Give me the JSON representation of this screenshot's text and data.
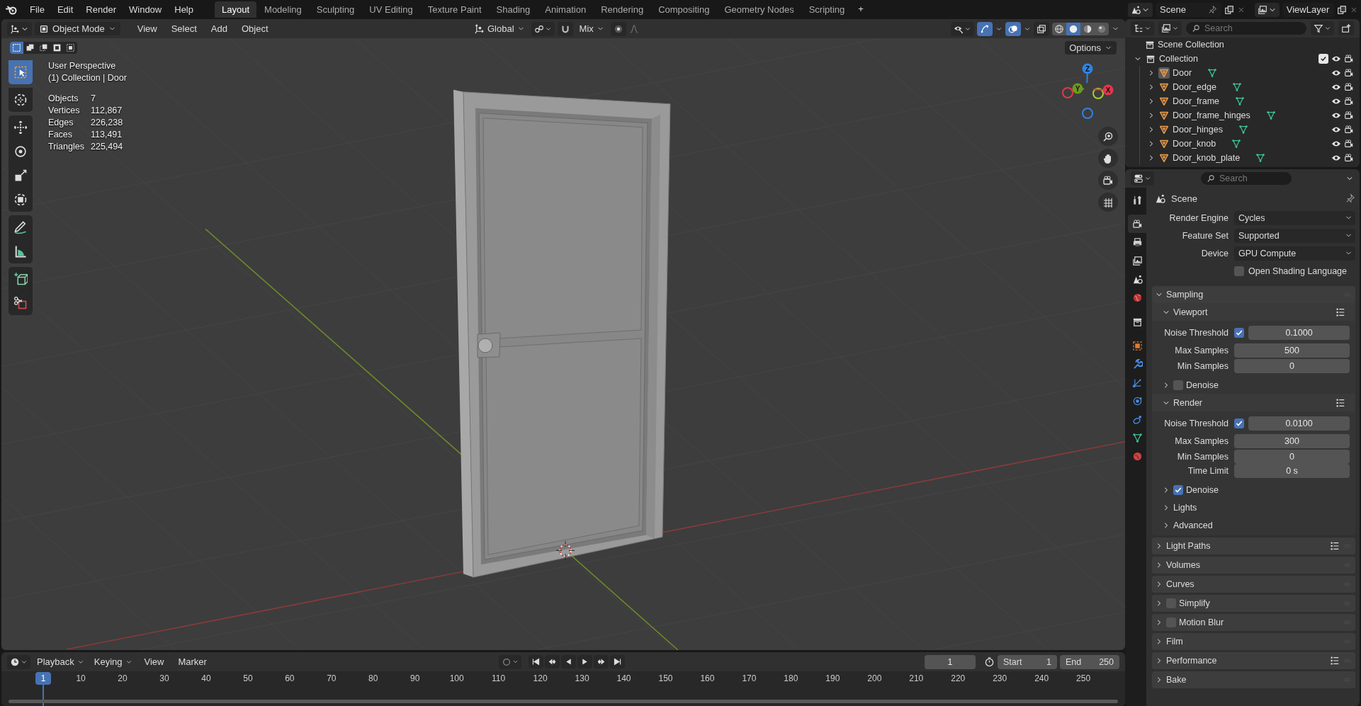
{
  "topbar": {
    "menus": [
      "File",
      "Edit",
      "Render",
      "Window",
      "Help"
    ],
    "workspaces": [
      {
        "label": "Layout",
        "selected": true
      },
      {
        "label": "Modeling",
        "selected": false
      },
      {
        "label": "Sculpting",
        "selected": false
      },
      {
        "label": "UV Editing",
        "selected": false
      },
      {
        "label": "Texture Paint",
        "selected": false
      },
      {
        "label": "Shading",
        "selected": false
      },
      {
        "label": "Animation",
        "selected": false
      },
      {
        "label": "Rendering",
        "selected": false
      },
      {
        "label": "Compositing",
        "selected": false
      },
      {
        "label": "Geometry Nodes",
        "selected": false
      },
      {
        "label": "Scripting",
        "selected": false
      }
    ],
    "add_workspace": "+",
    "scene": "Scene",
    "view_layer": "ViewLayer"
  },
  "viewport": {
    "mode": "Object Mode",
    "menus": [
      "View",
      "Select",
      "Add",
      "Object"
    ],
    "orientation": "Global",
    "snap": "Mix",
    "select_modes": [
      {
        "selected": true
      },
      {
        "selected": false
      },
      {
        "selected": false
      },
      {
        "selected": false
      },
      {
        "selected": false
      }
    ],
    "shading_modes": [
      {
        "selected": false
      },
      {
        "selected": true
      },
      {
        "selected": false
      },
      {
        "selected": false
      }
    ],
    "options": "Options",
    "view_name": "User Perspective",
    "context": "(1) Collection | Door",
    "stats": [
      {
        "label": "Objects",
        "value": "7"
      },
      {
        "label": "Vertices",
        "value": "112,867"
      },
      {
        "label": "Edges",
        "value": "226,238"
      },
      {
        "label": "Faces",
        "value": "113,491"
      },
      {
        "label": "Triangles",
        "value": "225,494"
      }
    ],
    "tools": [
      {
        "selected": true
      },
      {
        "selected": false
      },
      {
        "selected": false
      },
      {
        "selected": false
      },
      {
        "selected": false
      },
      {
        "selected": false
      },
      {
        "selected": false
      },
      {
        "selected": false
      },
      {
        "selected": false
      },
      {
        "selected": false
      }
    ],
    "gizmo_axes": [
      "Z",
      "Y",
      "X"
    ]
  },
  "timeline": {
    "menus": [
      {
        "label": "Playback",
        "dropdown": true
      },
      {
        "label": "Keying",
        "dropdown": true
      },
      {
        "label": "View",
        "dropdown": false
      },
      {
        "label": "Marker",
        "dropdown": false
      }
    ],
    "current_frame": "1",
    "start_label": "Start",
    "start": "1",
    "end_label": "End",
    "end": "250",
    "ruler_labels": [
      "10",
      "20",
      "30",
      "40",
      "50",
      "60",
      "70",
      "80",
      "90",
      "100",
      "110",
      "120",
      "130",
      "140",
      "150",
      "160",
      "170",
      "180",
      "190",
      "200",
      "210",
      "220",
      "230",
      "240",
      "250"
    ],
    "playhead": "1"
  },
  "outliner": {
    "search": {
      "placeholder": "Search"
    },
    "root": "Scene Collection",
    "collection": {
      "name": "Collection",
      "expanded": true,
      "checked": true,
      "children": [
        {
          "name": "Door",
          "selected": true,
          "expanded": false
        },
        {
          "name": "Door_edge",
          "selected": false,
          "expanded": false
        },
        {
          "name": "Door_frame",
          "selected": false,
          "expanded": false
        },
        {
          "name": "Door_frame_hinges",
          "selected": false,
          "expanded": false
        },
        {
          "name": "Door_hinges",
          "selected": false,
          "expanded": false
        },
        {
          "name": "Door_knob",
          "selected": false,
          "expanded": false
        },
        {
          "name": "Door_knob_plate",
          "selected": false,
          "expanded": false
        }
      ]
    }
  },
  "properties": {
    "search": {
      "placeholder": "Search"
    },
    "context": "Scene",
    "tabs": [
      {
        "selected": false
      },
      {
        "selected": true
      },
      {
        "selected": false
      },
      {
        "selected": false
      },
      {
        "selected": false
      },
      {
        "selected": false
      },
      {
        "selected": false
      },
      {
        "selected": false
      },
      {
        "selected": false
      },
      {
        "selected": false
      },
      {
        "selected": false
      },
      {
        "selected": false
      },
      {
        "selected": false
      },
      {
        "selected": false
      }
    ],
    "fields": [
      {
        "kind": "dropdown",
        "label": "Render Engine",
        "value": "Cycles"
      },
      {
        "kind": "dropdown",
        "label": "Feature Set",
        "value": "Supported"
      },
      {
        "kind": "dropdown",
        "label": "Device",
        "value": "GPU Compute"
      },
      {
        "kind": "checkbox",
        "label": "Open Shading Language",
        "checked": false
      }
    ],
    "panels": [
      {
        "title": "Sampling",
        "expanded": true,
        "children": [
          {
            "title": "Viewport",
            "expanded": true,
            "presets": true,
            "fields": [
              {
                "kind": "toggle_number",
                "label": "Noise Threshold",
                "checked": true,
                "value": "0.1000"
              },
              {
                "kind": "number",
                "label": "Max Samples",
                "value": "500"
              },
              {
                "kind": "number",
                "label": "Min Samples",
                "value": "0"
              }
            ]
          },
          {
            "title": "Denoise",
            "expanded": false,
            "checked": false
          },
          {
            "title": "Render",
            "expanded": true,
            "presets": true,
            "fields": [
              {
                "kind": "toggle_number",
                "label": "Noise Threshold",
                "checked": true,
                "value": "0.0100"
              },
              {
                "kind": "number",
                "label": "Max Samples",
                "value": "300"
              },
              {
                "kind": "number",
                "label": "Min Samples",
                "value": "0"
              },
              {
                "kind": "number",
                "label": "Time Limit",
                "value": "0 s"
              }
            ]
          },
          {
            "title": "Denoise",
            "expanded": false,
            "checked": true
          },
          {
            "title": "Lights",
            "expanded": false
          },
          {
            "title": "Advanced",
            "expanded": false
          }
        ]
      },
      {
        "title": "Light Paths",
        "expanded": false,
        "presets": true
      },
      {
        "title": "Volumes",
        "expanded": false
      },
      {
        "title": "Curves",
        "expanded": false
      },
      {
        "title": "Simplify",
        "expanded": false,
        "checked": false
      },
      {
        "title": "Motion Blur",
        "expanded": false,
        "checked": false
      },
      {
        "title": "Film",
        "expanded": false
      },
      {
        "title": "Performance",
        "expanded": false,
        "presets": true
      },
      {
        "title": "Bake",
        "expanded": false
      }
    ]
  }
}
